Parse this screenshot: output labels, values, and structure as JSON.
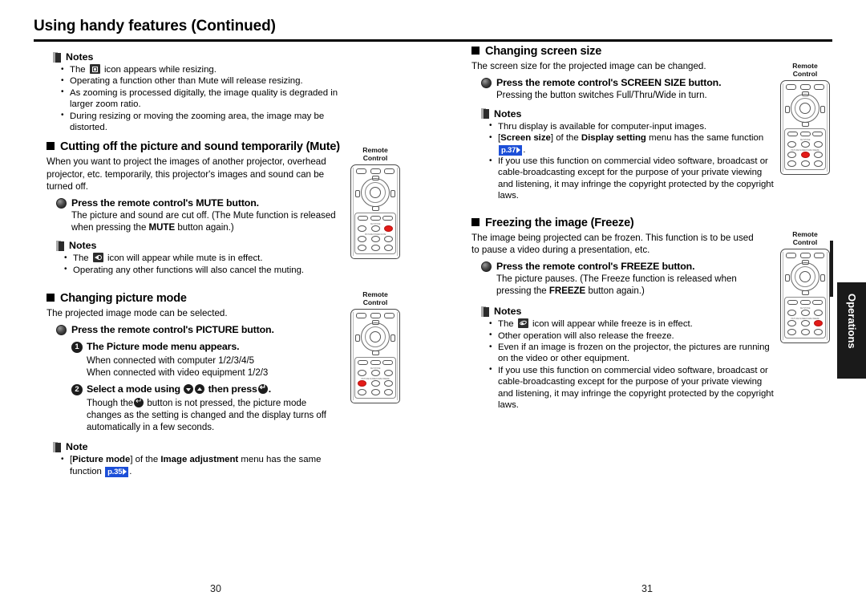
{
  "document": {
    "title": "Using handy features (Continued)",
    "left_page_number": "30",
    "right_page_number": "31",
    "side_tab_label": "Operations",
    "remote_label": "Remote\nControl",
    "page_ref_p35": "p.35",
    "page_ref_p37": "p.37"
  },
  "left_column": {
    "notes_top": {
      "heading": "Notes",
      "items": [
        {
          "pre": "The",
          "icon": "resize-icon",
          "post": "icon appears while resizing."
        },
        {
          "pre": "Operating a function other than Mute will release resizing.",
          "icon": null,
          "post": ""
        },
        {
          "pre": "As zooming is processed digitally, the image quality is degraded in larger zoom ratio.",
          "icon": null,
          "post": ""
        },
        {
          "pre": "During resizing or moving the zooming area, the image may be distorted.",
          "icon": null,
          "post": ""
        }
      ]
    },
    "section_mute": {
      "heading": "Cutting off the picture and sound temporarily (Mute)",
      "intro": "When you want to project the images of another projector, overhead projector, etc. temporarily, this projector's images and sound can be turned off.",
      "step": "Press the remote control's MUTE button.",
      "step_body_a": "The picture and sound are cut off. (The Mute function is released",
      "step_body_b_pre": "when pressing the",
      "step_body_b_bold": "MUTE",
      "step_body_b_post": "button again.)",
      "notes_heading": "Notes",
      "note_1_pre": "The",
      "note_1_icon": "mute-icon",
      "note_1_post": "icon will appear while mute is in effect.",
      "note_2": "Operating any other functions will also cancel the muting."
    },
    "section_picture": {
      "heading": "Changing picture mode",
      "intro": "The projected image mode can be selected.",
      "step": "Press the remote control's PICTURE button.",
      "num1_label": "1",
      "num1_text": "The Picture mode menu appears.",
      "num1_body_a": "When connected with computer  1/2/3/4/5",
      "num1_body_b": "When connected with video equipment  1/2/3",
      "num2_label": "2",
      "num2_text_a": "Select a mode using",
      "num2_text_b": "then press",
      "num2_text_c": ".",
      "num2_body": "Though the ⏎ button is not pressed, the picture mode changes as the setting is changed and the display turns off automatically in a few seconds.",
      "num2_body_a": "Though the",
      "num2_body_b": "button is not pressed, the picture mode",
      "num2_body_c": "changes as the setting is changed and the display turns off",
      "num2_body_d": "automatically in a few seconds.",
      "note_heading": "Note",
      "note_1_a": "[",
      "note_1_bold1": "Picture mode",
      "note_1_b": "] of the",
      "note_1_bold2": "Image adjustment",
      "note_1_c": "menu has the same",
      "note_1_d": "function",
      "note_1_e": "."
    }
  },
  "right_column": {
    "section_screen_size": {
      "heading": "Changing screen size",
      "intro": "The screen size for the projected image can be changed.",
      "step": "Press the remote control's SCREEN SIZE button.",
      "step_body": "Pressing the button switches Full/Thru/Wide in turn.",
      "notes_heading": "Notes",
      "note_1": "Thru display is available for computer-input images.",
      "note_2_a": "[",
      "note_2_bold1": "Screen size",
      "note_2_b": "] of the",
      "note_2_bold2": "Display setting",
      "note_2_c": "menu has the same function",
      "note_2_d": ".",
      "note_3": "If you use this function on commercial video software, broadcast or cable-broadcasting except for the purpose of your private viewing and listening, it may infringe the copyright protected by the copyright laws."
    },
    "section_freeze": {
      "heading": "Freezing the image (Freeze)",
      "intro": "The image being projected can be frozen. This function is to be used to pause a video during a presentation, etc.",
      "step": "Press the remote control's FREEZE button.",
      "step_body_a": "The picture pauses. (The Freeze function is released when",
      "step_body_b_pre": "pressing the",
      "step_body_b_bold": "FREEZE",
      "step_body_b_post": "button again.)",
      "notes_heading": "Notes",
      "note_1_pre": "The",
      "note_1_icon": "freeze-icon",
      "note_1_post": "icon will appear while freeze is in effect.",
      "note_2": "Other operation will also release the freeze.",
      "note_3": "Even if an image is frozen on the projector, the pictures are running on the video or other equipment.",
      "note_4": "If you use this function on commercial video software, broadcast or cable-broadcasting except for the purpose of your private viewing and listening, it may infringe the copyright protected by the copyright laws."
    }
  },
  "colors": {
    "page_ref_badge": "#1c4fd8",
    "highlight_key": "#e41b18",
    "side_tab": "#1a1a1a"
  }
}
